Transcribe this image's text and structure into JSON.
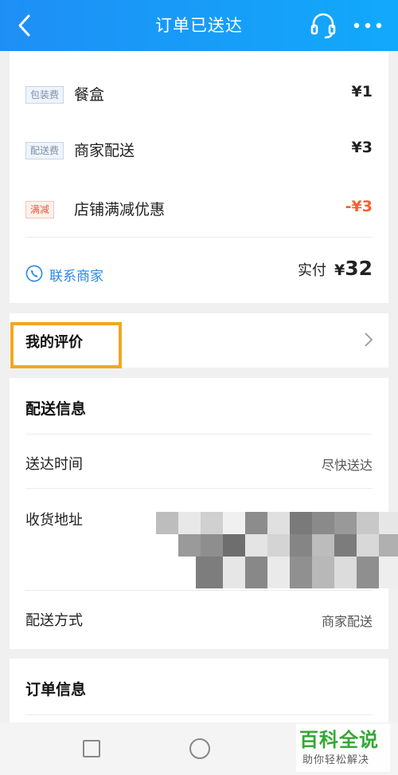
{
  "header": {
    "title": "订单已送达",
    "back_icon": "chevron-left-icon",
    "support_icon": "headset-icon",
    "more_icon": "more-dots-icon",
    "bg_color": "#1e8ff6"
  },
  "fees": [
    {
      "tag": "包装费",
      "name": "餐盒",
      "price": "¥1",
      "tag_style": "blue"
    },
    {
      "tag": "配送费",
      "name": "商家配送",
      "price": "¥3",
      "tag_style": "blue"
    },
    {
      "tag": "满减",
      "name": "店铺满减优惠",
      "price": "-¥3",
      "tag_style": "red"
    }
  ],
  "contact": {
    "label": "联系商家",
    "icon": "phone-icon"
  },
  "paid": {
    "label": "实付",
    "currency": "¥",
    "amount": "32"
  },
  "review": {
    "label": "我的评价",
    "icon": "chevron-right-icon"
  },
  "delivery": {
    "title": "配送信息",
    "rows": [
      {
        "label": "送达时间",
        "value": "尽快送达"
      },
      {
        "label": "收货地址",
        "value": ""
      },
      {
        "label": "配送方式",
        "value": "商家配送"
      }
    ]
  },
  "order": {
    "title": "订单信息"
  },
  "watermark": {
    "title": "百科全说",
    "subtitle": "助你轻松解决"
  },
  "colors": {
    "accent": "#2a8ae0",
    "discount": "#f3612e",
    "highlight": "#f5a623"
  }
}
